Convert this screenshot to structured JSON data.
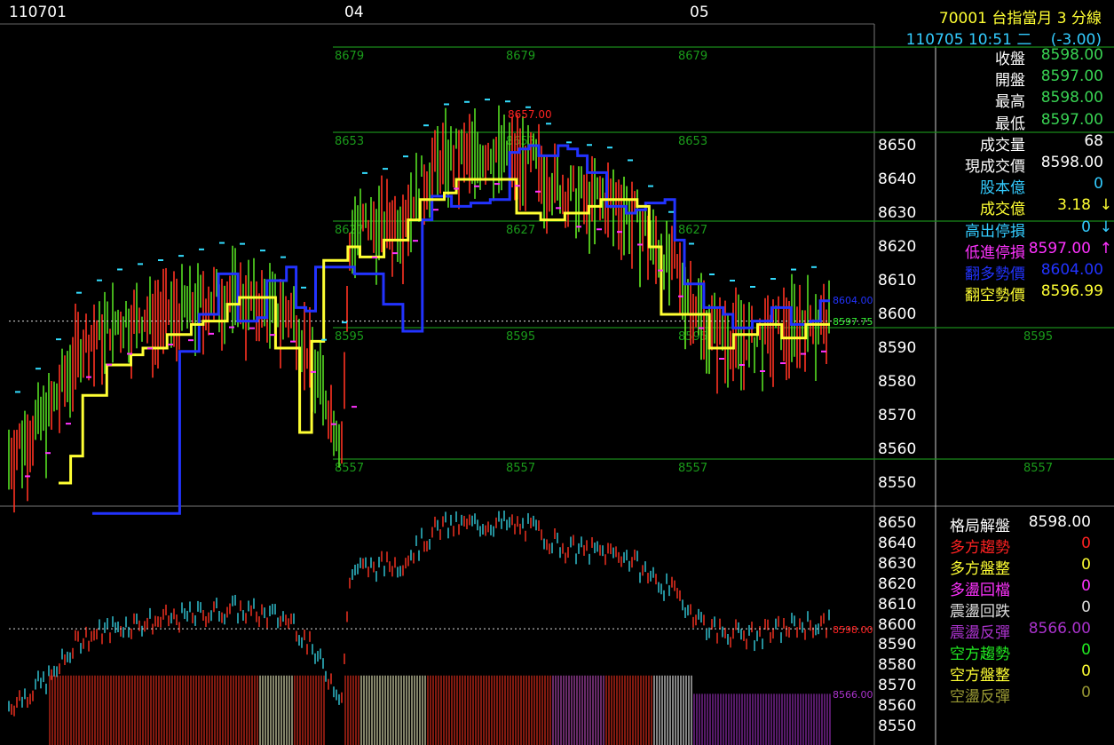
{
  "header": {
    "dates": [
      "110701",
      "04",
      "05"
    ],
    "symbol_line": "70001  台指當月 3 分線",
    "time_line": "110705 10:51 二",
    "change": "(-3.00)"
  },
  "quote": [
    {
      "label": "收盤",
      "value": "8598.00",
      "label_color": "#ffffff",
      "value_color": "#39d353"
    },
    {
      "label": "開盤",
      "value": "8597.00",
      "label_color": "#ffffff",
      "value_color": "#39d353"
    },
    {
      "label": "最高",
      "value": "8598.00",
      "label_color": "#ffffff",
      "value_color": "#39d353"
    },
    {
      "label": "最低",
      "value": "8597.00",
      "label_color": "#ffffff",
      "value_color": "#39d353"
    },
    {
      "label": "成交量",
      "value": "68",
      "label_color": "#ffffff",
      "value_color": "#ffffff"
    },
    {
      "label": "現成交價",
      "value": "8598.00",
      "label_color": "#ffffff",
      "value_color": "#ffffff"
    },
    {
      "label": "股本億",
      "value": "0",
      "label_color": "#33ccff",
      "value_color": "#33ccff"
    },
    {
      "label": "成交億",
      "value": "3.18",
      "label_color": "#ffff33",
      "value_color": "#ffff33",
      "arrow": "↓",
      "arrow_color": "#ffff33"
    },
    {
      "label": "高出停損",
      "value": "0",
      "label_color": "#33ccff",
      "value_color": "#33ccff",
      "arrow": "↓",
      "arrow_color": "#33ccff"
    },
    {
      "label": "低進停損",
      "value": "8597.00",
      "label_color": "#ff33ff",
      "value_color": "#ff33ff",
      "arrow": "↑",
      "arrow_color": "#ff33ff"
    },
    {
      "label": "翻多勢價",
      "value": "8604.00",
      "label_color": "#2233ff",
      "value_color": "#2233ff"
    },
    {
      "label": "翻空勢價",
      "value": "8596.99",
      "label_color": "#ffff33",
      "value_color": "#ffff33"
    }
  ],
  "pattern": [
    {
      "label": "格局解盤",
      "value": "8598.00",
      "label_color": "#ffffff",
      "value_color": "#ffffff"
    },
    {
      "label": "多方趨勢",
      "value": "0",
      "label_color": "#ff2222",
      "value_color": "#ff2222"
    },
    {
      "label": "多方盤整",
      "value": "0",
      "label_color": "#ffff33",
      "value_color": "#ffff33"
    },
    {
      "label": "多盪回檔",
      "value": "0",
      "label_color": "#ff33ff",
      "value_color": "#ff33ff"
    },
    {
      "label": "震盪回跌",
      "value": "0",
      "label_color": "#dddddd",
      "value_color": "#dddddd"
    },
    {
      "label": "震盪反彈",
      "value": "8566.00",
      "label_color": "#aa33cc",
      "value_color": "#aa33cc"
    },
    {
      "label": "空方趨勢",
      "value": "0",
      "label_color": "#22ee22",
      "value_color": "#22ee22"
    },
    {
      "label": "空方盤整",
      "value": "0",
      "label_color": "#ffff33",
      "value_color": "#ffff33"
    },
    {
      "label": "空盪反彈",
      "value": "0",
      "label_color": "#999933",
      "value_color": "#999933"
    }
  ],
  "top_axis": [
    "8650",
    "8640",
    "8630",
    "8620",
    "8610",
    "8600",
    "8590",
    "8580",
    "8570",
    "8560",
    "8550"
  ],
  "bottom_axis": [
    "8650",
    "8640",
    "8630",
    "8620",
    "8610",
    "8600",
    "8590",
    "8580",
    "8570",
    "8560",
    "8550"
  ],
  "levels": [
    {
      "value": "8679",
      "color": "#1a8a1a"
    },
    {
      "value": "8653",
      "color": "#1a8a1a"
    },
    {
      "value": "8627",
      "color": "#1a8a1a"
    },
    {
      "value": "8595",
      "color": "#1a8a1a"
    },
    {
      "value": "8557",
      "color": "#1a8a1a"
    }
  ],
  "annotations": {
    "high_mark": "8657.00",
    "blue_mark": "8604.00",
    "green_mark": "8597.75",
    "close_mark": "8598.00",
    "pattern_mark": "8566.00"
  },
  "chart_data": {
    "type": "line",
    "series": [
      {
        "name": "翻多勢價",
        "color": "#2233ff",
        "values": [
          8541,
          8541,
          8541,
          8541,
          8541,
          8541,
          8541,
          8541,
          8541,
          8589,
          8589,
          8600,
          8600,
          8612,
          8612,
          8598,
          8598,
          8599,
          8610,
          8610,
          8614,
          8602,
          8601,
          8614,
          8614,
          8614,
          8614,
          8612,
          8612,
          8612,
          8603,
          8603,
          8595,
          8595,
          8628,
          8635,
          8635,
          8632,
          8632,
          8633,
          8633,
          8634,
          8634,
          8648,
          8649,
          8650,
          8647,
          8647,
          8650,
          8649,
          8647,
          8642,
          8642,
          8632,
          8632,
          8630,
          8631,
          8633,
          8633,
          8634,
          8622,
          8609,
          8609,
          8602,
          8602,
          8600,
          8596,
          8596,
          8598,
          8598,
          8602,
          8602,
          8597,
          8597,
          8598,
          8604
        ]
      },
      {
        "name": "翻空勢價",
        "color": "#ffff33",
        "values": [
          8550,
          8558,
          8576,
          8576,
          8585,
          8585,
          8588,
          8590,
          8590,
          8594,
          8594,
          8597,
          8598,
          8598,
          8603,
          8605,
          8605,
          8605,
          8590,
          8590,
          8565,
          8592,
          8616,
          8616,
          8620,
          8617,
          8617,
          8622,
          8622,
          8628,
          8634,
          8634,
          8636,
          8640,
          8640,
          8640,
          8640,
          8640,
          8630,
          8630,
          8628,
          8628,
          8630,
          8630,
          8632,
          8634,
          8634,
          8634,
          8632,
          8620,
          8600,
          8600,
          8600,
          8600,
          8590,
          8590,
          8594,
          8594,
          8597,
          8597,
          8593,
          8593,
          8597,
          8597
        ]
      }
    ],
    "ylim": [
      8546,
      8661
    ],
    "xlabel": "",
    "ylabel": ""
  }
}
